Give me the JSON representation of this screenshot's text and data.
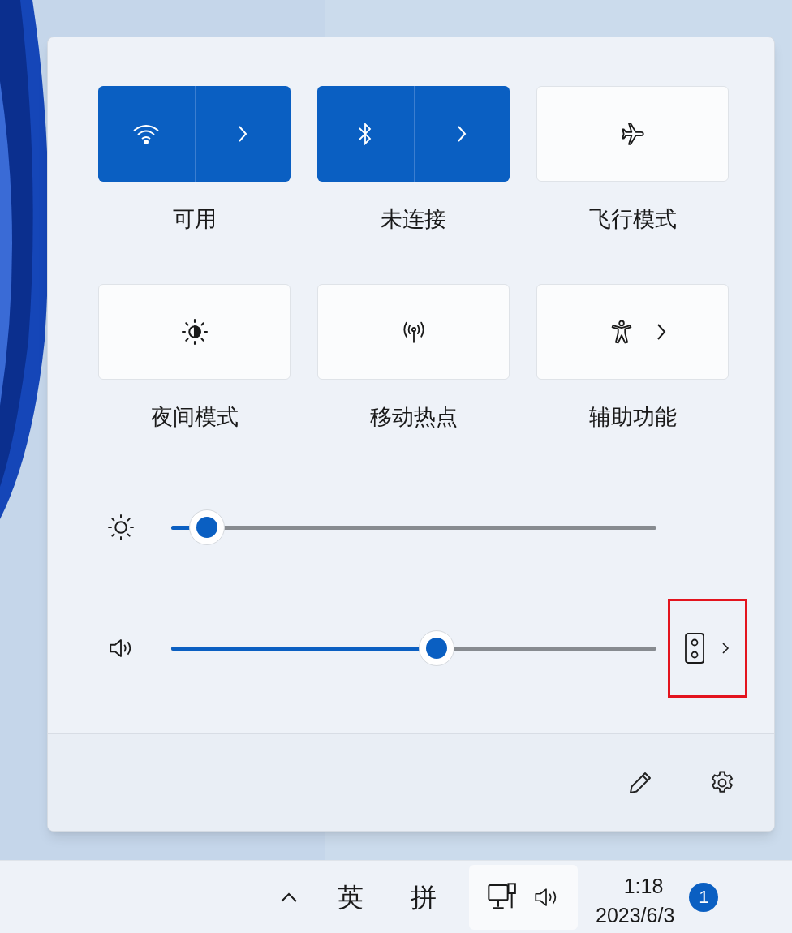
{
  "tiles": [
    {
      "kind": "split",
      "on": true,
      "label": "可用"
    },
    {
      "kind": "split",
      "on": true,
      "label": "未连接"
    },
    {
      "kind": "plain",
      "on": false,
      "label": "飞行模式"
    },
    {
      "kind": "plain",
      "on": false,
      "label": "夜间模式"
    },
    {
      "kind": "plain",
      "on": false,
      "label": "移动热点"
    },
    {
      "kind": "chevron",
      "on": false,
      "label": "辅助功能"
    }
  ],
  "sliders": [
    {
      "kind": "brightness",
      "level": 0.074
    },
    {
      "kind": "volume",
      "level": 0.547,
      "highlighted": true
    }
  ],
  "taskbar": {
    "input_modes": [
      "英",
      "拼"
    ],
    "time": "1:18",
    "date": "2023/6/3",
    "notification_count": "1"
  }
}
